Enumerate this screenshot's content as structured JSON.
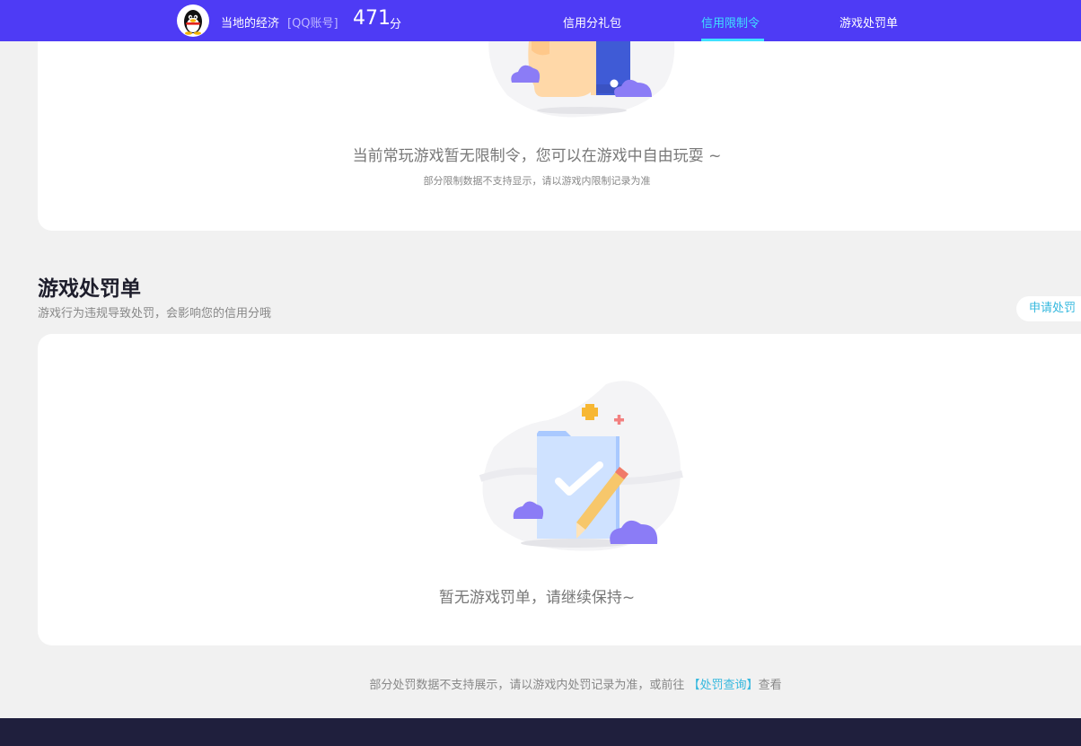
{
  "header": {
    "avatar_icon": "qq-penguin-icon",
    "user_name": "当地的经济",
    "account_tag": "[QQ账号]",
    "score": "471",
    "score_unit": "分",
    "nav": [
      {
        "label": "信用分礼包",
        "active": false
      },
      {
        "label": "信用限制令",
        "active": true
      },
      {
        "label": "游戏处罚单",
        "active": false
      }
    ],
    "accent_color": "#3fe1ff",
    "bar_color": "#4e3bf5"
  },
  "restriction": {
    "illustration_icon": "phone-hand-illustration-icon",
    "empty_message": "当前常玩游戏暂无限制令，您可以在游戏中自由玩耍 ~",
    "note": "部分限制数据不支持显示，请以游戏内限制记录为准"
  },
  "penalty": {
    "title": "游戏处罚单",
    "description": "游戏行为违规导致处罚，会影响您的信用分哦",
    "apply_button": "申请处罚",
    "illustration_icon": "folder-check-pencil-illustration-icon",
    "empty_message": "暂无游戏罚单，请继续保持~"
  },
  "footer": {
    "note_prefix": "部分处罚数据不支持展示，请以游戏内处罚记录为准，或前往 ",
    "link_label": "【处罚查询】",
    "note_suffix": "查看",
    "bar_color": "#1f1f3d"
  }
}
